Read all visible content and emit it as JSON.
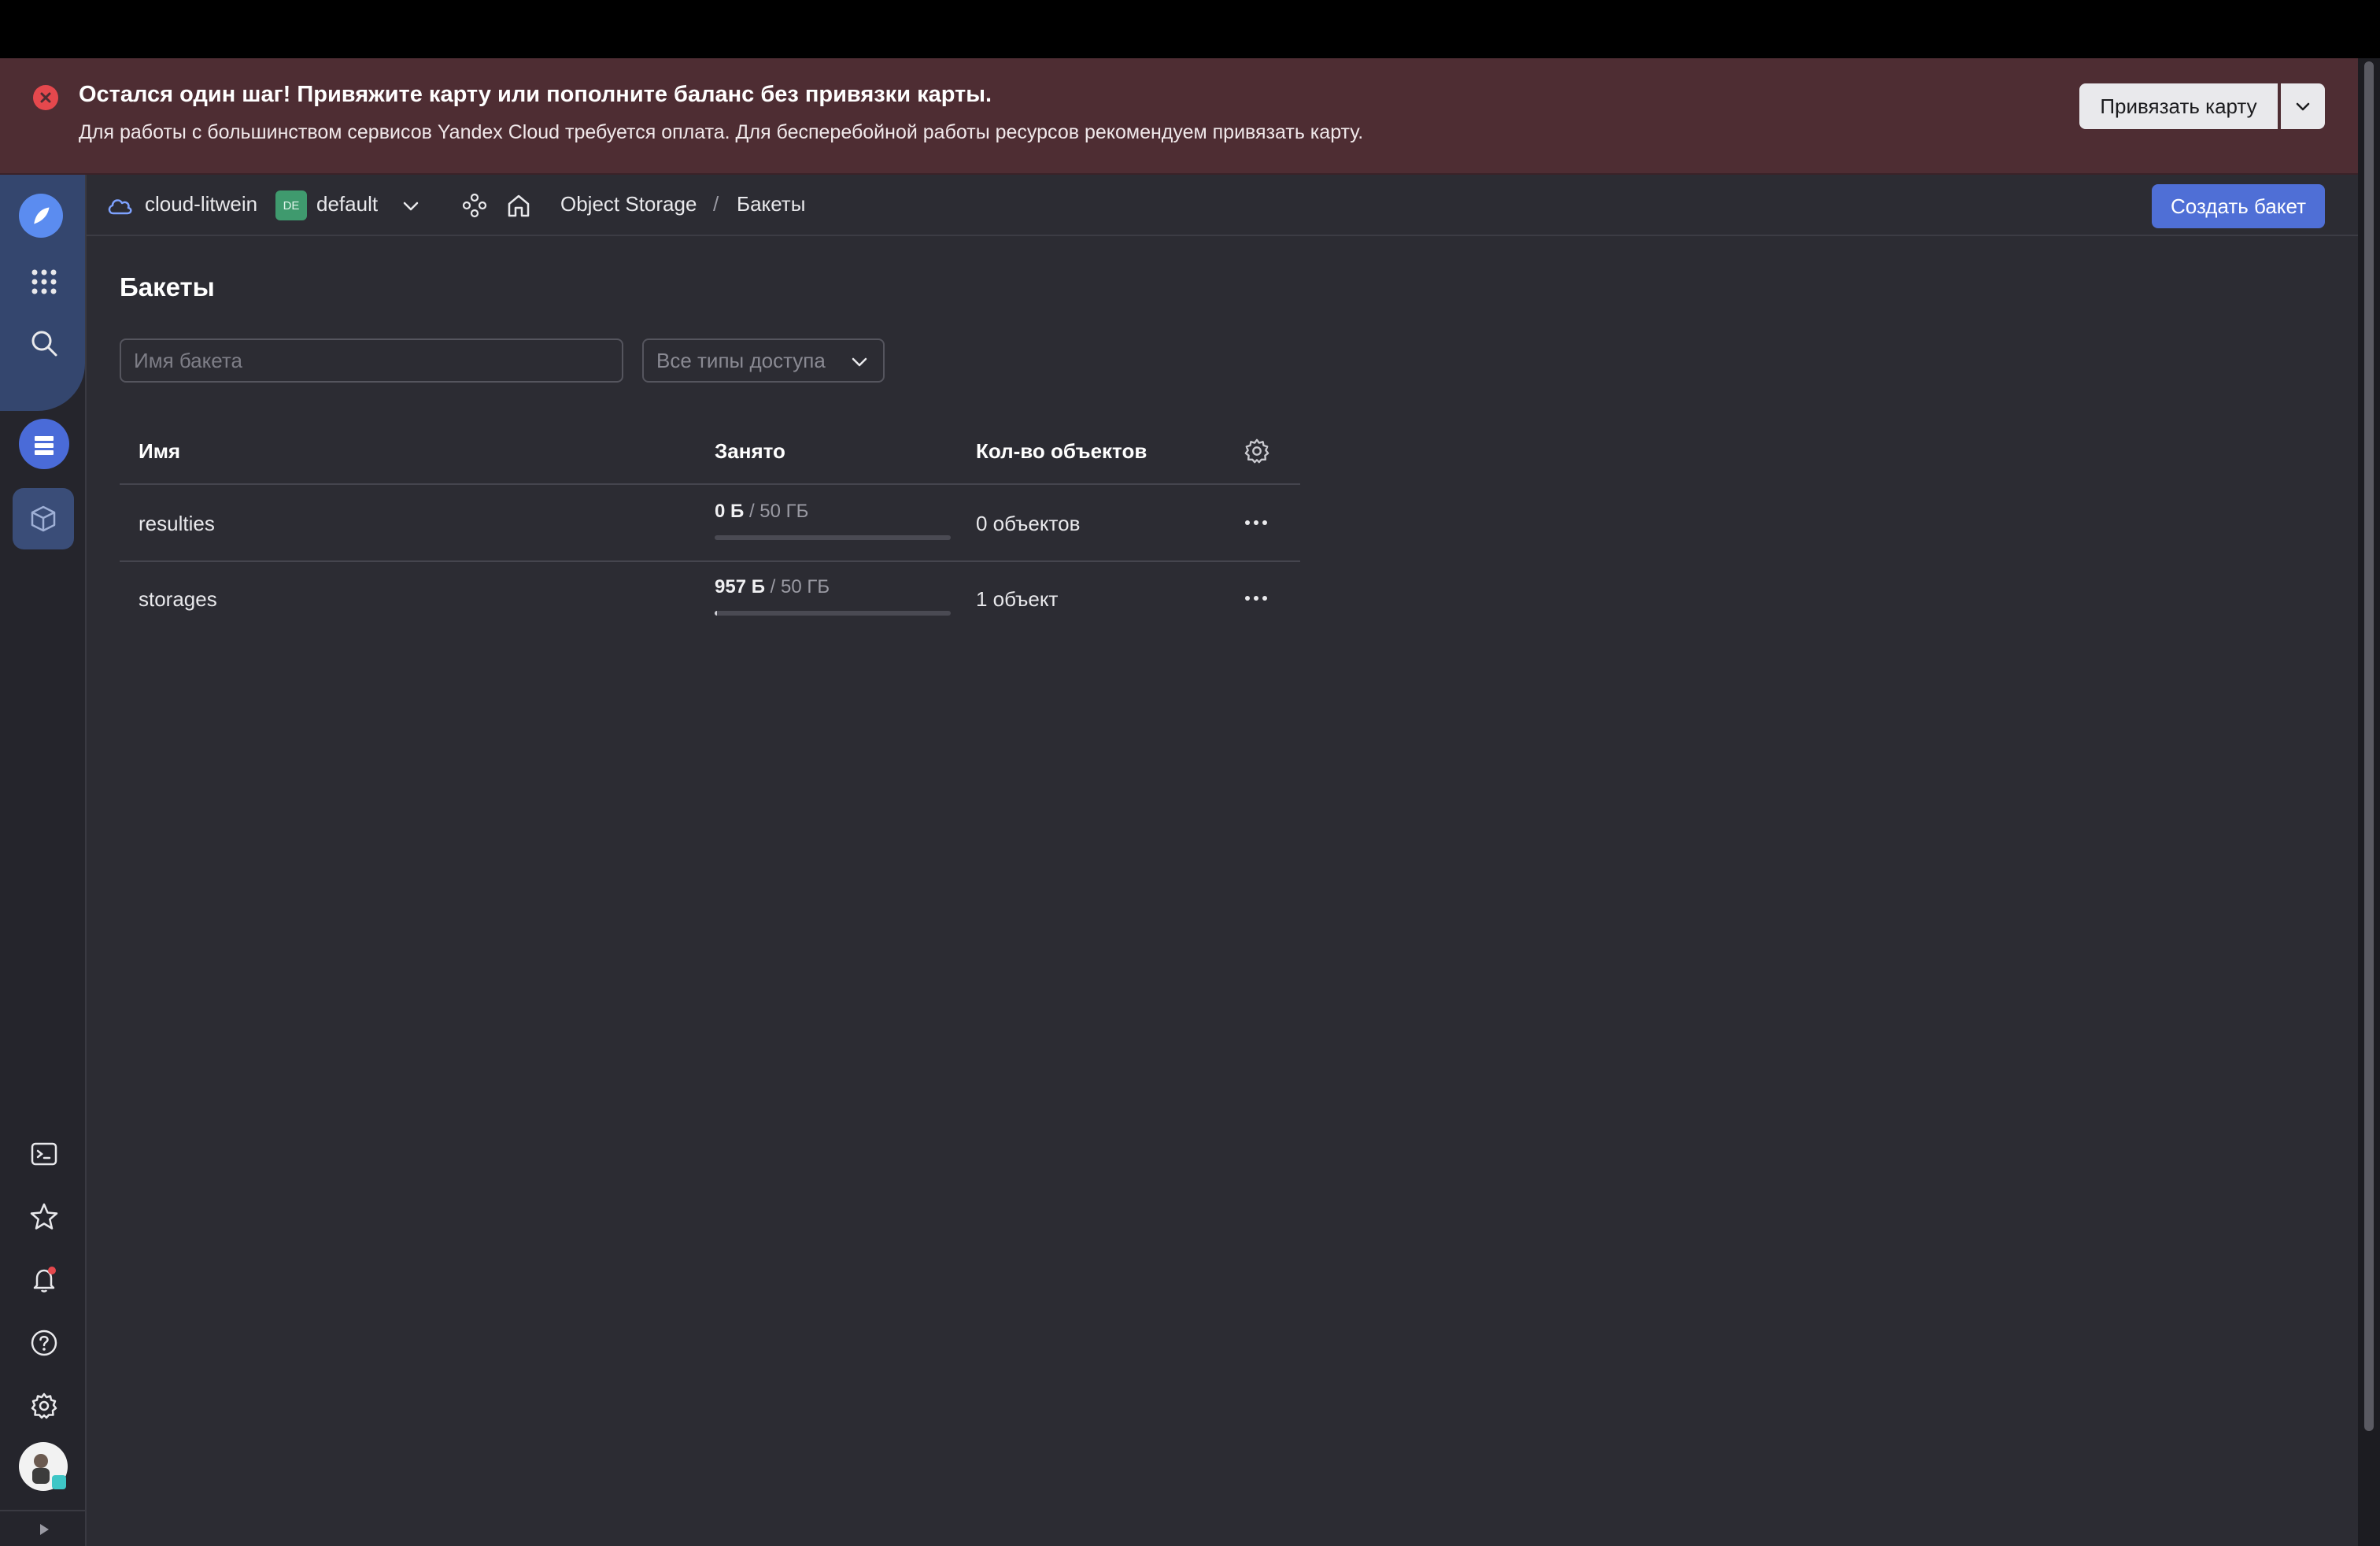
{
  "banner": {
    "title": "Остался один шаг! Привяжите карту или пополните баланс без привязки карты.",
    "subtitle": "Для работы с большинством сервисов Yandex Cloud требуется оплата. Для бесперебойной работы ресурсов рекомендуем привязать карту.",
    "bind_button": "Привязать карту"
  },
  "header": {
    "cloud": "cloud-litwein",
    "folder_badge": "DE",
    "folder": "default",
    "breadcrumb_service": "Object Storage",
    "breadcrumb_sep": "/",
    "breadcrumb_current": "Бакеты",
    "create_button": "Создать бакет"
  },
  "page": {
    "title": "Бакеты",
    "search_placeholder": "Имя бакета",
    "access_filter": "Все типы доступа"
  },
  "table": {
    "columns": [
      "Имя",
      "Занято",
      "Кол-во объектов"
    ],
    "rows": [
      {
        "name": "resulties",
        "used": "0 Б",
        "limit": "/ 50 ГБ",
        "usage_fraction": 0.0,
        "objects": "0 объектов"
      },
      {
        "name": "storages",
        "used": "957 Б",
        "limit": "/ 50 ГБ",
        "usage_fraction": 0.01,
        "objects": "1 объект"
      }
    ]
  },
  "colors": {
    "banner_bg": "#4e2d33",
    "accent": "#4f6fd6",
    "error": "#e5484d",
    "background": "#2c2c33"
  }
}
